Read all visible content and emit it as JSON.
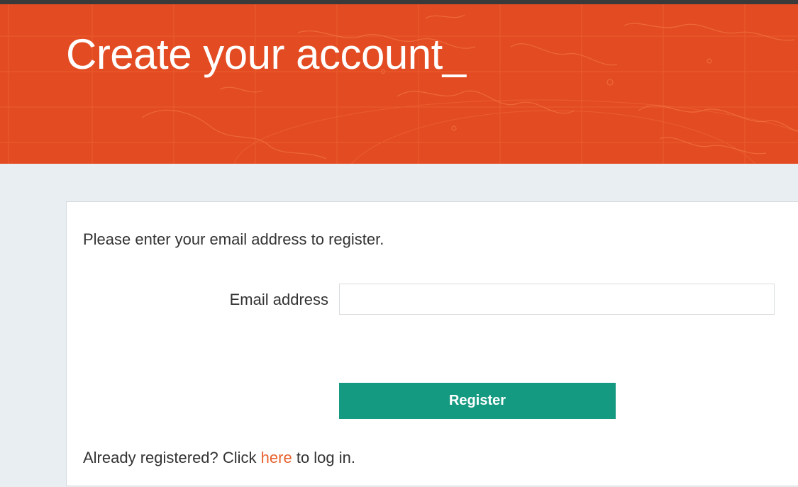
{
  "colors": {
    "hero_background": "#e34c22",
    "accent_link": "#e8632f",
    "button_background": "#159a82",
    "page_background": "#e8eef1"
  },
  "hero": {
    "title": "Create your account_"
  },
  "form": {
    "intro_text": "Please enter your email address to register.",
    "email_label": "Email address",
    "email_value": "",
    "email_placeholder": "",
    "register_label": "Register"
  },
  "login": {
    "prefix": "Already registered? Click ",
    "link_text": "here",
    "suffix": " to log in."
  }
}
